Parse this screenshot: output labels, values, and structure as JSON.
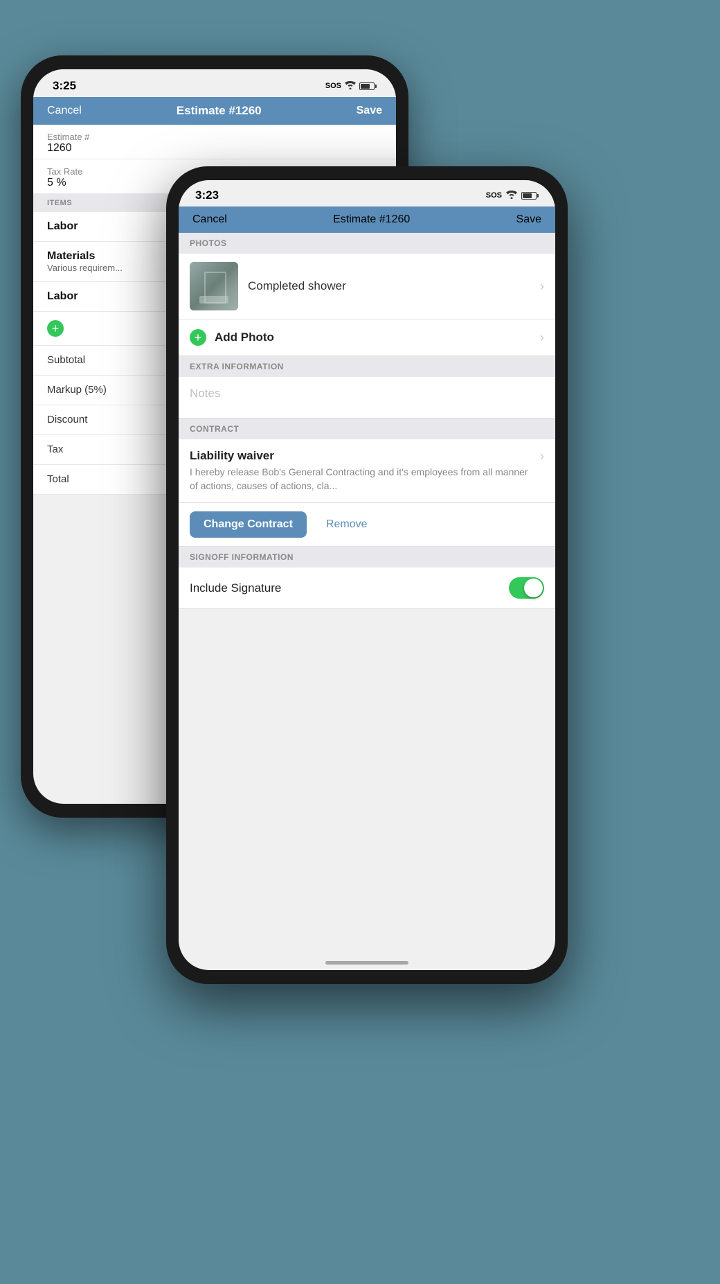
{
  "background_color": "#5a8a9a",
  "phone_back": {
    "status_bar": {
      "time": "3:25",
      "sos": "SOS",
      "wifi": "wifi",
      "battery": "battery"
    },
    "nav_bar": {
      "cancel": "Cancel",
      "title": "Estimate #1260",
      "save": "Save"
    },
    "fields": [
      {
        "label": "Estimate #",
        "value": "1260"
      },
      {
        "label": "Tax Rate",
        "value": "5 %"
      }
    ],
    "items_section": "ITEMS",
    "items": [
      {
        "name": "Labor",
        "sub": ""
      },
      {
        "name": "Materials",
        "sub": "Various requirem..."
      },
      {
        "name": "Labor",
        "sub": ""
      }
    ],
    "summary_rows": [
      "Subtotal",
      "Markup (5%)",
      "Discount",
      "Tax",
      "Total"
    ]
  },
  "phone_front": {
    "status_bar": {
      "time": "3:23",
      "sos": "SOS",
      "wifi": "wifi",
      "battery": "battery"
    },
    "nav_bar": {
      "cancel": "Cancel",
      "title": "Estimate #1260",
      "save": "Save"
    },
    "photos_section": "PHOTOS",
    "photo_item": {
      "label": "Completed shower",
      "has_image": true
    },
    "add_photo": {
      "icon": "+",
      "label": "Add Photo"
    },
    "extra_info_section": "EXTRA INFORMATION",
    "notes_placeholder": "Notes",
    "contract_section": "CONTRACT",
    "contract": {
      "title": "Liability waiver",
      "text": "I hereby release Bob's General Contracting and it's employees from all manner of actions, causes of actions, cla..."
    },
    "change_contract_button": "Change Contract",
    "remove_button": "Remove",
    "signoff_section": "SIGNOFF INFORMATION",
    "include_signature": {
      "label": "Include Signature",
      "enabled": true
    }
  }
}
